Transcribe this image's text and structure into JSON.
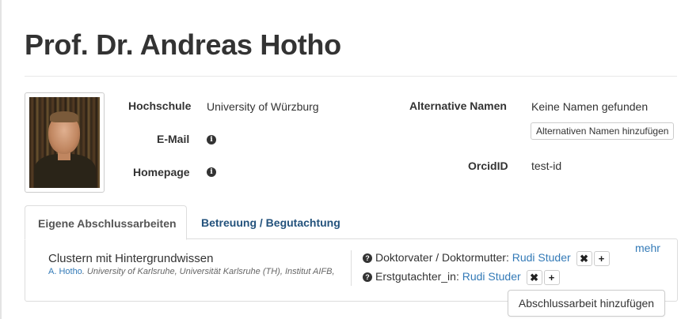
{
  "profile": {
    "name": "Prof. Dr. Andreas Hotho"
  },
  "details": {
    "university_label": "Hochschule",
    "university_value": "University of Würzburg",
    "email_label": "E-Mail",
    "homepage_label": "Homepage",
    "alt_names_label": "Alternative Namen",
    "alt_names_value": "Keine Namen gefunden",
    "alt_names_button": "Alternativen Namen hinzufügen",
    "orcid_label": "OrcidID",
    "orcid_value": "test-id"
  },
  "tabs": [
    {
      "label": "Eigene Abschlussarbeiten",
      "active": true
    },
    {
      "label": "Betreuung / Begutachtung",
      "active": false
    }
  ],
  "thesis": {
    "title": "Clustern mit Hintergrundwissen",
    "author": "A. Hotho",
    "institution": ". University of Karlsruhe, Universität Karlsruhe (TH), Institut AIFB,",
    "more_label": "mehr",
    "roles": [
      {
        "role": "Doktorvater / Doktormutter:",
        "person": "Rudi Studer"
      },
      {
        "role": "Erstgutachter_in:",
        "person": "Rudi Studer"
      }
    ],
    "remove_symbol": "✖",
    "add_symbol": "+"
  },
  "actions": {
    "add_thesis_button": "Abschlussarbeit hinzufügen"
  },
  "icons": {
    "info": "info-icon",
    "question": "question-icon"
  },
  "colors": {
    "link": "#337ab7",
    "tab_link": "#23527c",
    "text": "#333333"
  }
}
